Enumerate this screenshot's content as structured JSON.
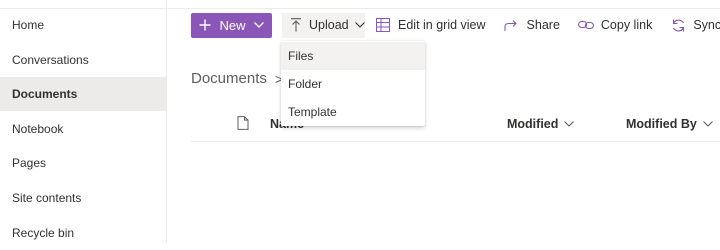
{
  "sidebar": {
    "items": [
      {
        "label": "Home"
      },
      {
        "label": "Conversations"
      },
      {
        "label": "Documents",
        "active": true
      },
      {
        "label": "Notebook"
      },
      {
        "label": "Pages"
      },
      {
        "label": "Site contents"
      },
      {
        "label": "Recycle bin"
      }
    ]
  },
  "toolbar": {
    "new_label": "New",
    "upload_label": "Upload",
    "grid_label": "Edit in grid view",
    "share_label": "Share",
    "copy_link_label": "Copy link",
    "sync_label": "Sync"
  },
  "upload_menu": {
    "items": [
      {
        "label": "Files",
        "highlighted": true
      },
      {
        "label": "Folder"
      },
      {
        "label": "Template"
      }
    ]
  },
  "breadcrumb": {
    "label": "Documents",
    "separator": ">"
  },
  "list": {
    "columns": {
      "name": "Name",
      "modified": "Modified",
      "modified_by": "Modified By"
    }
  },
  "colors": {
    "accent": "#8a56b8",
    "selected": "#edebe9",
    "hover": "#f3f2f1"
  },
  "icons": [
    "plus-icon",
    "chevron-down-icon",
    "upload-arrow-icon",
    "grid-icon",
    "share-icon",
    "link-icon",
    "sync-icon",
    "file-icon"
  ]
}
